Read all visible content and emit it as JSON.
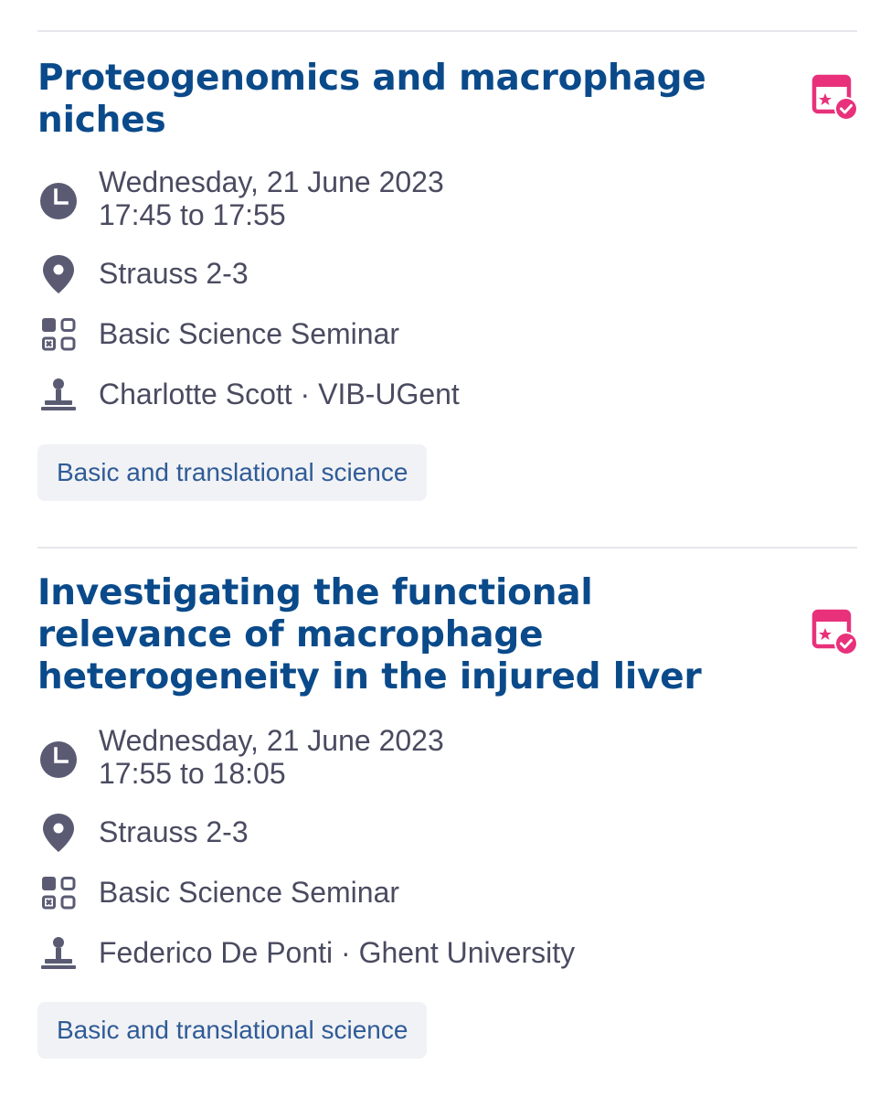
{
  "sessions": [
    {
      "title": "Proteogenomics and macrophage niches",
      "date": "Wednesday, 21 June 2023",
      "time": "17:45 to 17:55",
      "location": "Strauss 2-3",
      "session_type": "Basic Science Seminar",
      "speaker": "Charlotte Scott · VIB-UGent",
      "tag": "Basic and translational science"
    },
    {
      "title": "Investigating the functional relevance of macrophage heterogeneity in the injured liver",
      "date": "Wednesday, 21 June 2023",
      "time": "17:55 to 18:05",
      "location": "Strauss 2-3",
      "session_type": "Basic Science Seminar",
      "speaker": "Federico De Ponti · Ghent University",
      "tag": "Basic and translational science"
    }
  ],
  "icons": {
    "time": "clock-icon",
    "location": "map-pin-icon",
    "type": "session-type-icon",
    "speaker": "speaker-podium-icon",
    "calendar": "calendar-added-icon"
  },
  "colors": {
    "title": "#0a4a8a",
    "body_text": "#4a4b60",
    "icon": "#5a5b73",
    "accent": "#e8317a",
    "tag_bg": "#f1f2f5",
    "tag_text": "#2f5b97",
    "divider": "#e6e7ec"
  }
}
